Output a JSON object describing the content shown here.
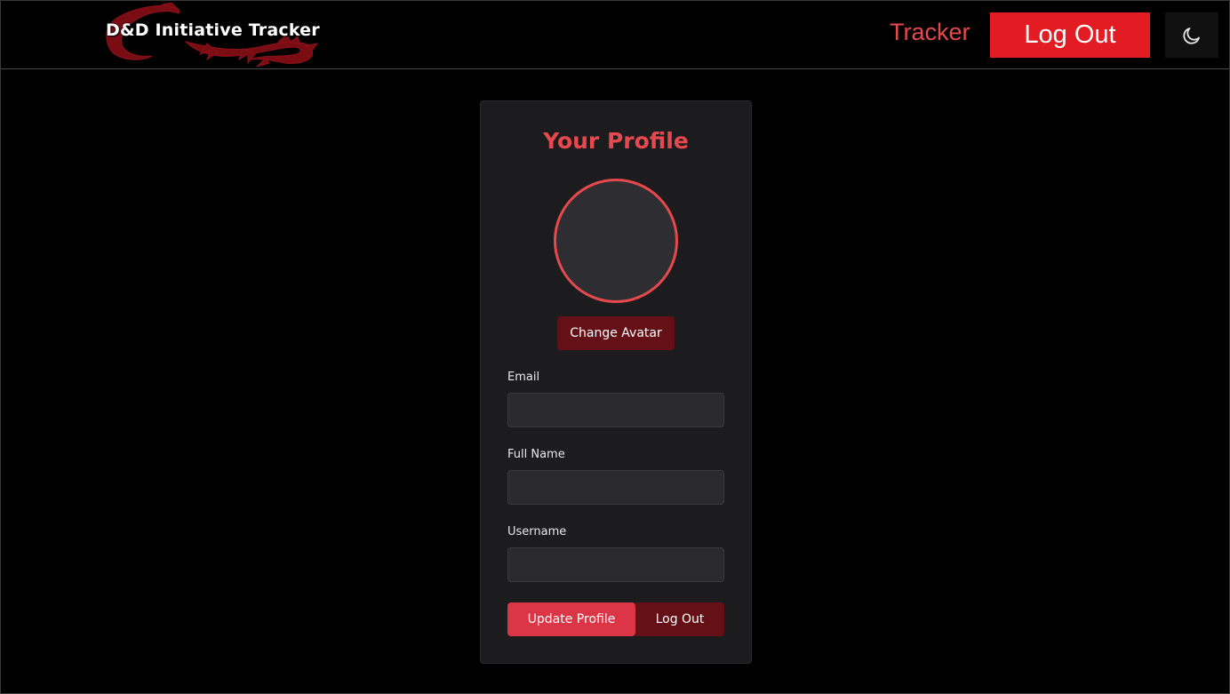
{
  "header": {
    "brand_title": "D&D Initiative Tracker",
    "nav_tracker_label": "Tracker",
    "nav_logout_label": "Log Out",
    "theme_toggle_icon": "moon-icon"
  },
  "profile": {
    "title": "Your Profile",
    "change_avatar_label": "Change Avatar",
    "fields": [
      {
        "label": "Email",
        "value": "",
        "placeholder": ""
      },
      {
        "label": "Full Name",
        "value": "",
        "placeholder": ""
      },
      {
        "label": "Username",
        "value": "",
        "placeholder": ""
      }
    ],
    "update_button_label": "Update Profile",
    "logout_button_label": "Log Out"
  },
  "colors": {
    "accent": "#e5484d",
    "primary_button": "#e31b23",
    "dark_red": "#641016",
    "card_bg": "#1c1c1e",
    "page_bg": "#000000"
  }
}
